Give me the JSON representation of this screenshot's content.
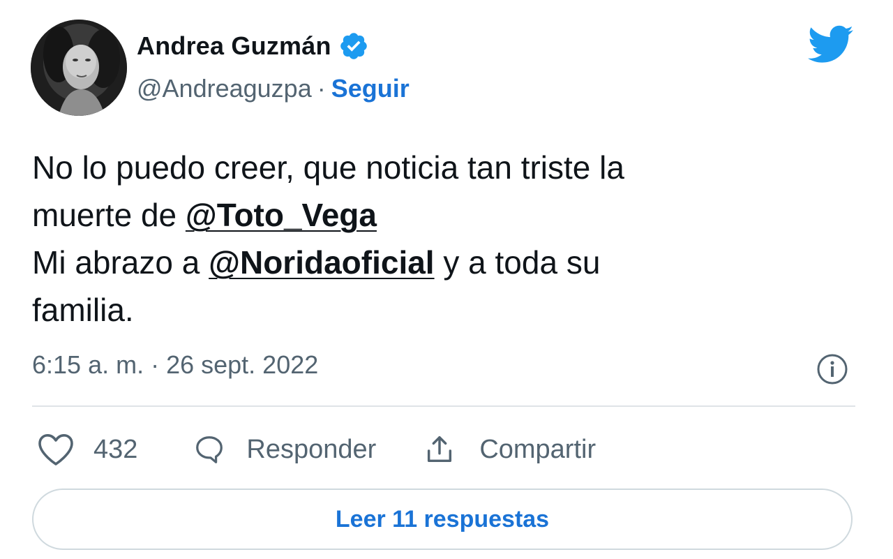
{
  "author": {
    "name": "Andrea Guzmán",
    "handle": "@Andreaguzpa",
    "separator": "·",
    "follow_label": "Seguir",
    "verified": true
  },
  "tweet": {
    "line1": "No lo puedo creer, que noticia tan triste la",
    "line2_prefix": "muerte de ",
    "mention1": "@Toto_Vega",
    "line3_prefix": "Mi abrazo a ",
    "mention2": "@Noridaoficial",
    "line3_suffix": " y a toda su",
    "line4": "familia.",
    "timestamp": "6:15 a. m. · 26 sept. 2022"
  },
  "actions": {
    "like_count": "432",
    "reply_label": "Responder",
    "share_label": "Compartir"
  },
  "read_replies_label": "Leer 11 respuestas",
  "icons": {
    "avatar": "profile-photo",
    "verified": "verified-badge-icon",
    "logo": "twitter-bird-icon",
    "info": "info-icon",
    "like": "heart-icon",
    "reply": "speech-bubble-icon",
    "share": "share-upload-icon"
  },
  "colors": {
    "accent": "#1d9bf0",
    "link": "#1a73d6",
    "text": "#0f1419",
    "muted": "#536471",
    "border": "#cfd9de"
  }
}
